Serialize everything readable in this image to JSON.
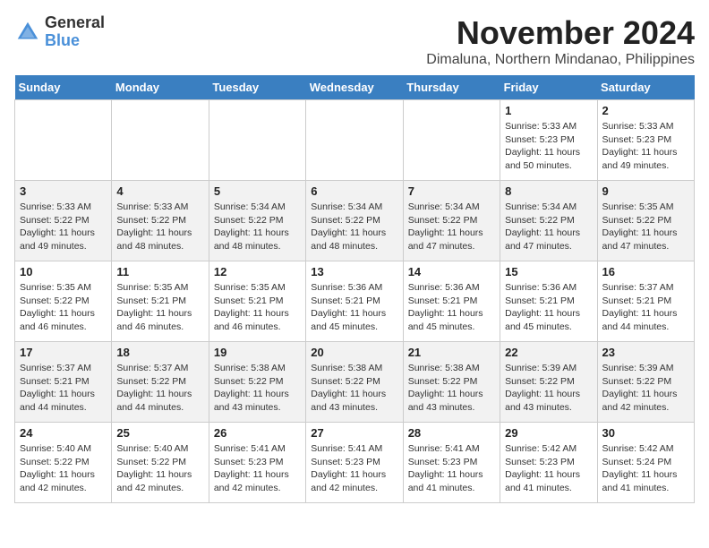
{
  "logo": {
    "general": "General",
    "blue": "Blue"
  },
  "title": "November 2024",
  "location": "Dimaluna, Northern Mindanao, Philippines",
  "headers": [
    "Sunday",
    "Monday",
    "Tuesday",
    "Wednesday",
    "Thursday",
    "Friday",
    "Saturday"
  ],
  "weeks": [
    [
      {
        "day": "",
        "info": ""
      },
      {
        "day": "",
        "info": ""
      },
      {
        "day": "",
        "info": ""
      },
      {
        "day": "",
        "info": ""
      },
      {
        "day": "",
        "info": ""
      },
      {
        "day": "1",
        "info": "Sunrise: 5:33 AM\nSunset: 5:23 PM\nDaylight: 11 hours and 50 minutes."
      },
      {
        "day": "2",
        "info": "Sunrise: 5:33 AM\nSunset: 5:23 PM\nDaylight: 11 hours and 49 minutes."
      }
    ],
    [
      {
        "day": "3",
        "info": "Sunrise: 5:33 AM\nSunset: 5:22 PM\nDaylight: 11 hours and 49 minutes."
      },
      {
        "day": "4",
        "info": "Sunrise: 5:33 AM\nSunset: 5:22 PM\nDaylight: 11 hours and 48 minutes."
      },
      {
        "day": "5",
        "info": "Sunrise: 5:34 AM\nSunset: 5:22 PM\nDaylight: 11 hours and 48 minutes."
      },
      {
        "day": "6",
        "info": "Sunrise: 5:34 AM\nSunset: 5:22 PM\nDaylight: 11 hours and 48 minutes."
      },
      {
        "day": "7",
        "info": "Sunrise: 5:34 AM\nSunset: 5:22 PM\nDaylight: 11 hours and 47 minutes."
      },
      {
        "day": "8",
        "info": "Sunrise: 5:34 AM\nSunset: 5:22 PM\nDaylight: 11 hours and 47 minutes."
      },
      {
        "day": "9",
        "info": "Sunrise: 5:35 AM\nSunset: 5:22 PM\nDaylight: 11 hours and 47 minutes."
      }
    ],
    [
      {
        "day": "10",
        "info": "Sunrise: 5:35 AM\nSunset: 5:22 PM\nDaylight: 11 hours and 46 minutes."
      },
      {
        "day": "11",
        "info": "Sunrise: 5:35 AM\nSunset: 5:21 PM\nDaylight: 11 hours and 46 minutes."
      },
      {
        "day": "12",
        "info": "Sunrise: 5:35 AM\nSunset: 5:21 PM\nDaylight: 11 hours and 46 minutes."
      },
      {
        "day": "13",
        "info": "Sunrise: 5:36 AM\nSunset: 5:21 PM\nDaylight: 11 hours and 45 minutes."
      },
      {
        "day": "14",
        "info": "Sunrise: 5:36 AM\nSunset: 5:21 PM\nDaylight: 11 hours and 45 minutes."
      },
      {
        "day": "15",
        "info": "Sunrise: 5:36 AM\nSunset: 5:21 PM\nDaylight: 11 hours and 45 minutes."
      },
      {
        "day": "16",
        "info": "Sunrise: 5:37 AM\nSunset: 5:21 PM\nDaylight: 11 hours and 44 minutes."
      }
    ],
    [
      {
        "day": "17",
        "info": "Sunrise: 5:37 AM\nSunset: 5:21 PM\nDaylight: 11 hours and 44 minutes."
      },
      {
        "day": "18",
        "info": "Sunrise: 5:37 AM\nSunset: 5:22 PM\nDaylight: 11 hours and 44 minutes."
      },
      {
        "day": "19",
        "info": "Sunrise: 5:38 AM\nSunset: 5:22 PM\nDaylight: 11 hours and 43 minutes."
      },
      {
        "day": "20",
        "info": "Sunrise: 5:38 AM\nSunset: 5:22 PM\nDaylight: 11 hours and 43 minutes."
      },
      {
        "day": "21",
        "info": "Sunrise: 5:38 AM\nSunset: 5:22 PM\nDaylight: 11 hours and 43 minutes."
      },
      {
        "day": "22",
        "info": "Sunrise: 5:39 AM\nSunset: 5:22 PM\nDaylight: 11 hours and 43 minutes."
      },
      {
        "day": "23",
        "info": "Sunrise: 5:39 AM\nSunset: 5:22 PM\nDaylight: 11 hours and 42 minutes."
      }
    ],
    [
      {
        "day": "24",
        "info": "Sunrise: 5:40 AM\nSunset: 5:22 PM\nDaylight: 11 hours and 42 minutes."
      },
      {
        "day": "25",
        "info": "Sunrise: 5:40 AM\nSunset: 5:22 PM\nDaylight: 11 hours and 42 minutes."
      },
      {
        "day": "26",
        "info": "Sunrise: 5:41 AM\nSunset: 5:23 PM\nDaylight: 11 hours and 42 minutes."
      },
      {
        "day": "27",
        "info": "Sunrise: 5:41 AM\nSunset: 5:23 PM\nDaylight: 11 hours and 42 minutes."
      },
      {
        "day": "28",
        "info": "Sunrise: 5:41 AM\nSunset: 5:23 PM\nDaylight: 11 hours and 41 minutes."
      },
      {
        "day": "29",
        "info": "Sunrise: 5:42 AM\nSunset: 5:23 PM\nDaylight: 11 hours and 41 minutes."
      },
      {
        "day": "30",
        "info": "Sunrise: 5:42 AM\nSunset: 5:24 PM\nDaylight: 11 hours and 41 minutes."
      }
    ]
  ]
}
